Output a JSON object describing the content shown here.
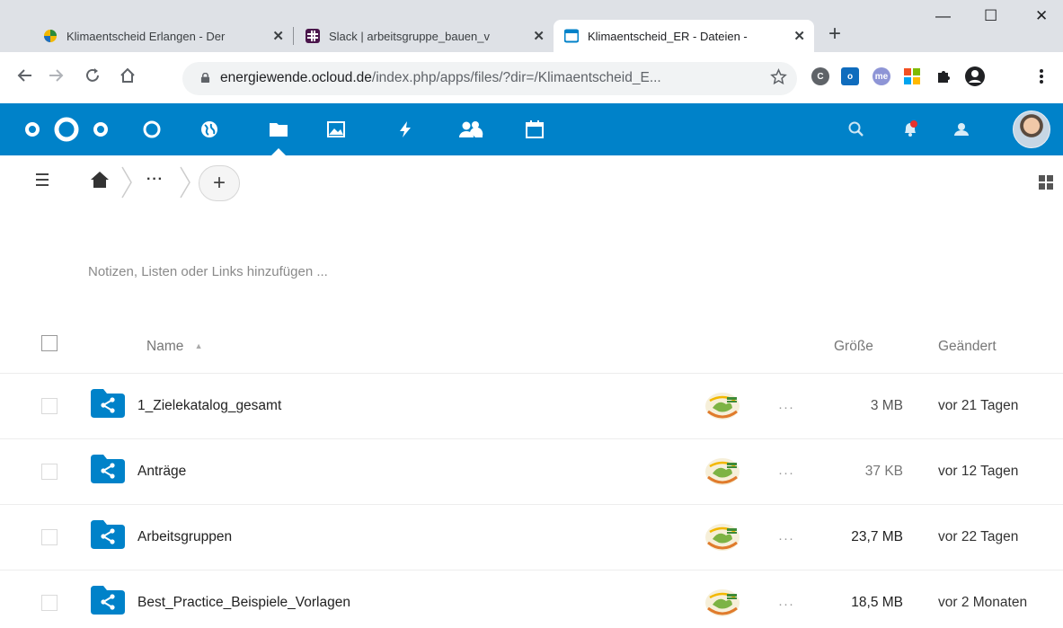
{
  "browser": {
    "tabs": [
      {
        "title": "Klimaentscheid Erlangen - Der",
        "close": "✕"
      },
      {
        "title": "Slack | arbeitsgruppe_bauen_v",
        "close": "✕"
      },
      {
        "title": "Klimaentscheid_ER - Dateien -",
        "close": "✕"
      }
    ],
    "new_tab": "+",
    "window": {
      "minimize": "—",
      "maximize": "☐",
      "close": "✕"
    },
    "url_host": "energiewende.ocloud.de",
    "url_path": "/index.php/apps/files/?dir=/Klimaentscheid_E...",
    "icons": {
      "back": "arrow-left-icon",
      "forward": "arrow-right-icon",
      "reload": "reload-icon",
      "home": "home-icon",
      "lock": "lock-icon",
      "bookmark": "star-icon",
      "menu": "kebab-menu-icon"
    },
    "extension_labels": [
      "C",
      "o",
      "me",
      ""
    ]
  },
  "nextcloud": {
    "brand_color": "#0082c9",
    "apps": [
      "dashboard",
      "activity-globe",
      "files",
      "photos",
      "activity",
      "contacts",
      "calendar"
    ],
    "header_right": [
      "search",
      "notifications",
      "contacts-menu",
      "user-avatar"
    ]
  },
  "controls": {
    "breadcrumb_more": "···",
    "add_label": "+"
  },
  "notes_placeholder": "Notizen, Listen oder Links hinzufügen ...",
  "table": {
    "headers": {
      "name": "Name",
      "sort_indicator": "▲",
      "size": "Größe",
      "modified": "Geändert"
    },
    "rows": [
      {
        "name": "1_Zielekatalog_gesamt",
        "size": "3 MB",
        "modified": "vor 21 Tagen",
        "size_color": "#555555"
      },
      {
        "name": "Anträge",
        "size": "37 KB",
        "modified": "vor 12 Tagen",
        "size_color": "#777777"
      },
      {
        "name": "Arbeitsgruppen",
        "size": "23,7 MB",
        "modified": "vor 22 Tagen",
        "size_color": "#222222"
      },
      {
        "name": "Best_Practice_Beispiele_Vorlagen",
        "size": "18,5 MB",
        "modified": "vor 2 Monaten",
        "size_color": "#222222"
      }
    ],
    "actions_label": "···"
  }
}
